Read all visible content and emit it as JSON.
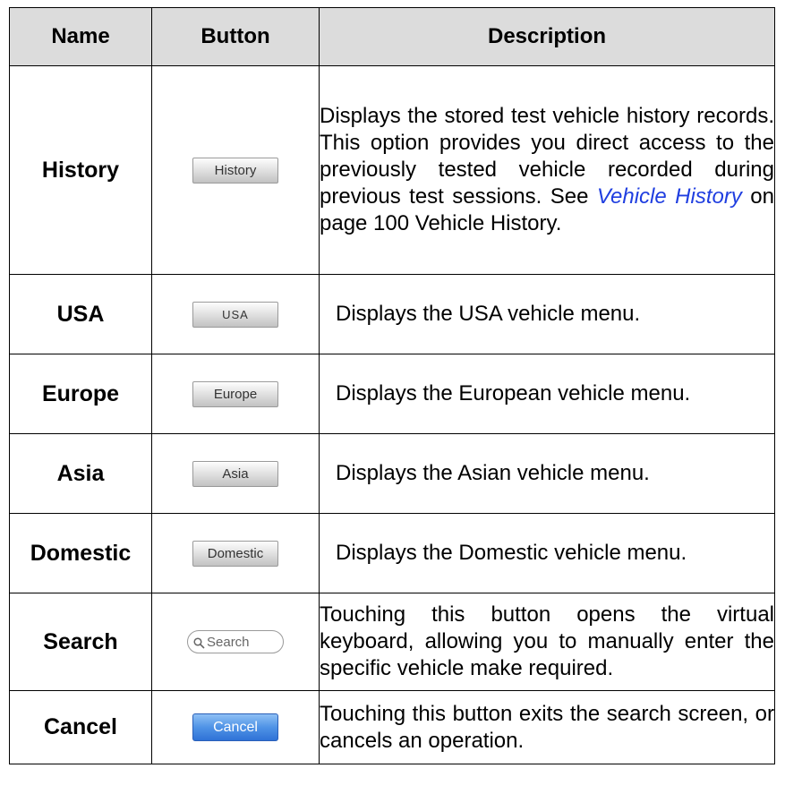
{
  "headers": {
    "name": "Name",
    "button": "Button",
    "description": "Description"
  },
  "rows": [
    {
      "name": "History",
      "button": "History",
      "desc_before": "Displays the stored test vehicle history records. This option provides you direct access to the previously tested vehicle recorded during previous test sessions. See ",
      "desc_link": "Vehicle History",
      "desc_after": " on page 100 Vehicle History."
    },
    {
      "name": "USA",
      "button": "USA",
      "desc": "Displays the USA vehicle menu."
    },
    {
      "name": "Europe",
      "button": "Europe",
      "desc": "Displays the European vehicle menu."
    },
    {
      "name": "Asia",
      "button": "Asia",
      "desc": "Displays the Asian vehicle menu."
    },
    {
      "name": "Domestic",
      "button": "Domestic",
      "desc": "Displays the Domestic vehicle menu."
    },
    {
      "name": "Search",
      "button": "Search",
      "desc": "Touching this button opens the virtual keyboard, allowing you to manually enter the specific vehicle make required."
    },
    {
      "name": "Cancel",
      "button": "Cancel",
      "desc": "Touching this button exits the search screen, or cancels an operation."
    }
  ],
  "colors": {
    "link": "#1f3ee0",
    "cancel_button": "#3f86e0",
    "header_bg": "#dcdcdc"
  },
  "icons": {
    "search_button": "magnifier-icon"
  }
}
